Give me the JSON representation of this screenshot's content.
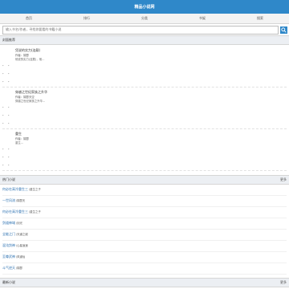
{
  "header": {
    "title": "精品小说网"
  },
  "nav": [
    "首页",
    "排行",
    "分类",
    "书架",
    "搜索"
  ],
  "search": {
    "placeholder": "输入书名/作者，寻找你要看的书籍小说"
  },
  "recommend": {
    "title": "封面推荐",
    "books": [
      {
        "title": "凭说的实力(连载)",
        "author": "作者：锦瑟",
        "desc": "他说的实力(连载)，他..."
      },
      {
        "title": "穿越之世纪家族之升华",
        "author": "作者：锦瑟天空",
        "desc": "穿越之世纪家族之升华..."
      },
      {
        "title": "重生",
        "author": "作者：锦瑟",
        "desc": "重生..."
      }
    ]
  },
  "hot": {
    "title": "热门小说",
    "more": "更多",
    "items": [
      {
        "title": "何必在高冷重生三",
        "author": "/重生之子"
      },
      {
        "title": "一世风流",
        "author": "/锦瑟天"
      },
      {
        "title": "何必在高冷重生三",
        "author": "/重生之子"
      },
      {
        "title": "剑道神域",
        "author": "/剑光"
      },
      {
        "title": "全能之门",
        "author": "/天道之巅"
      },
      {
        "title": "混沌剑神",
        "author": "/心星逍遥"
      },
      {
        "title": "至尊武神",
        "author": "/风道仙"
      },
      {
        "title": "斗气逆天",
        "author": "/锦瑟"
      }
    ]
  },
  "latest": {
    "title": "最新小说",
    "more": "更多"
  },
  "colors": {
    "accent": "#2f88c9",
    "link": "#2a6fb0"
  },
  "icons": {
    "search_button": "search-icon"
  }
}
